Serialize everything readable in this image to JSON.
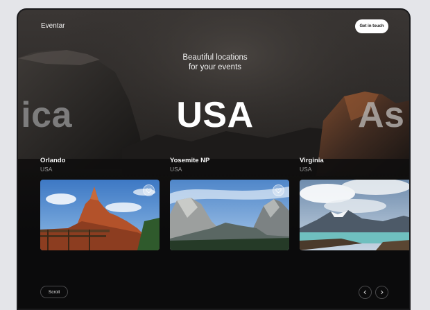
{
  "header": {
    "logo": "Eventar",
    "cta_label": "Get in touch"
  },
  "hero": {
    "tagline_line1": "Beautiful locations",
    "tagline_line2": "for your events",
    "current_region": "USA",
    "prev_region_fragment": "ica",
    "next_region_fragment": "As"
  },
  "cards": [
    {
      "city": "Orlando",
      "country": "USA",
      "icon": "heart-icon"
    },
    {
      "city": "Yosemite NP",
      "country": "USA",
      "icon": "heart-icon"
    },
    {
      "city": "Virginia",
      "country": "USA"
    }
  ],
  "footer": {
    "scroll_label": "Scroll",
    "prev_icon": "chevron-left-icon",
    "next_icon": "chevron-right-icon"
  },
  "colors": {
    "background": "#0b0b0c",
    "text_primary": "#ffffff",
    "text_muted": "#9a9a9a",
    "page_bg": "#e4e5e9"
  }
}
